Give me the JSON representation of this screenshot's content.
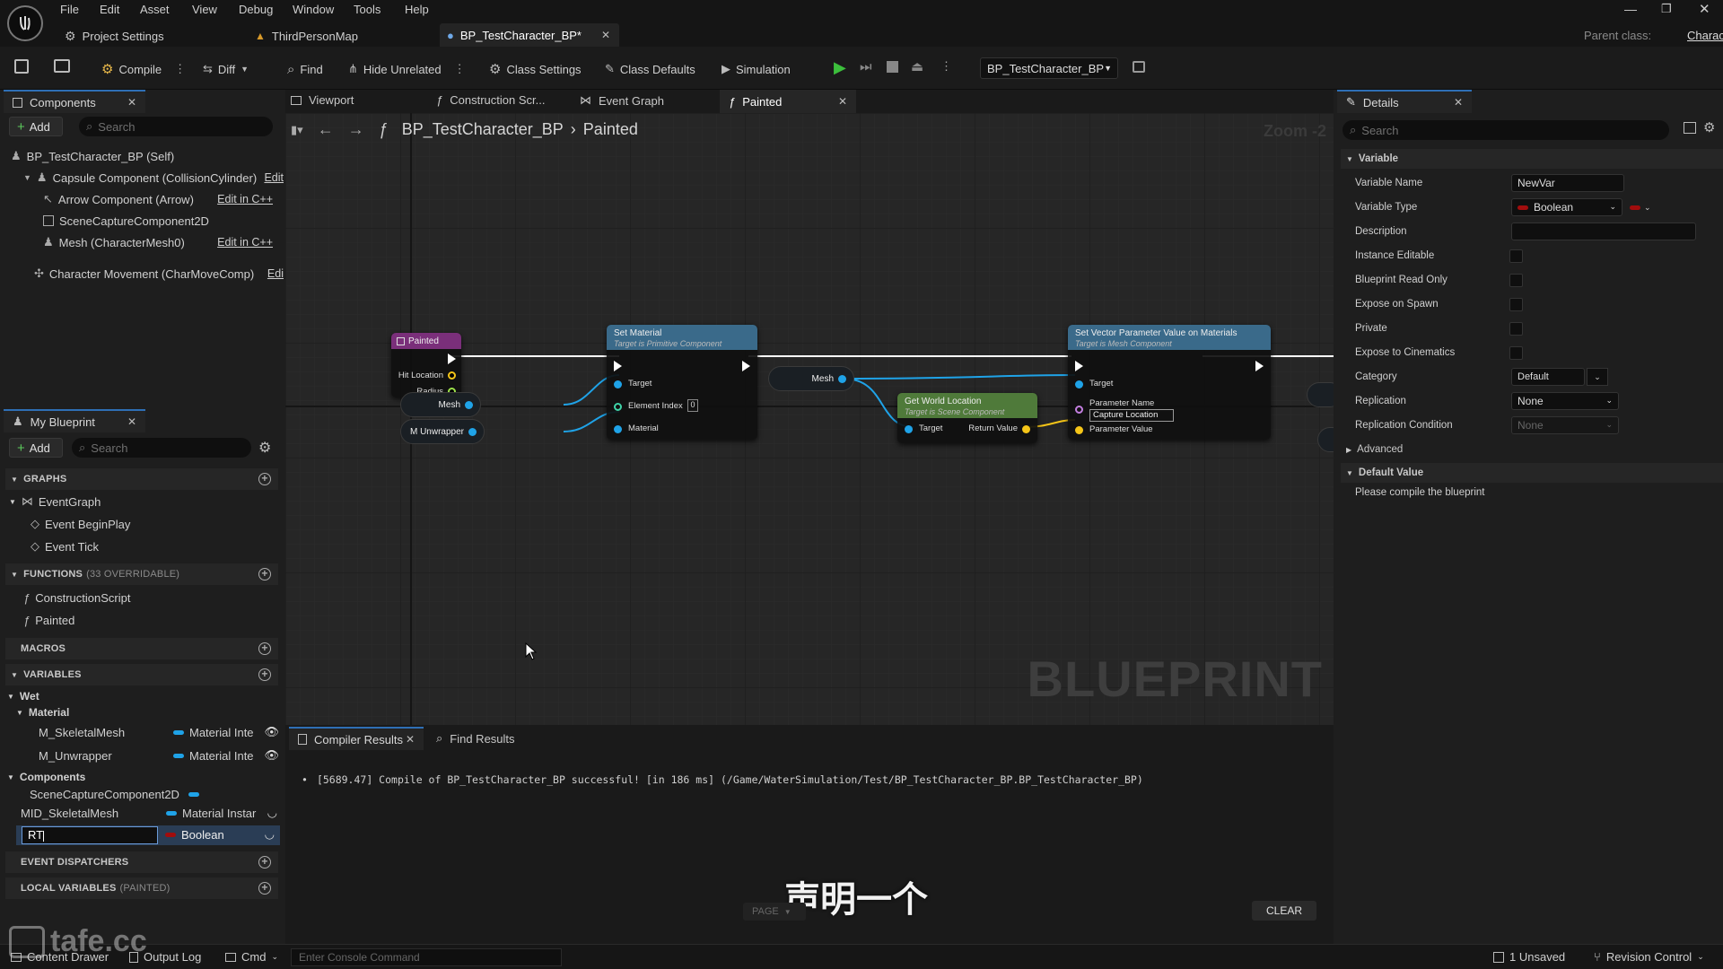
{
  "menu": [
    "File",
    "Edit",
    "Asset",
    "View",
    "Debug",
    "Window",
    "Tools",
    "Help"
  ],
  "doc_tabs": {
    "project_settings": "Project Settings",
    "third_person_map": "ThirdPersonMap",
    "bp_test": "BP_TestCharacter_BP*"
  },
  "parent_class": {
    "label": "Parent class:",
    "value": "Character"
  },
  "toolbar": {
    "compile": "Compile",
    "diff": "Diff",
    "find": "Find",
    "hide_unrelated": "Hide Unrelated",
    "class_settings": "Class Settings",
    "class_defaults": "Class Defaults",
    "simulation": "Simulation",
    "debug_object": "BP_TestCharacter_BP"
  },
  "components_panel": {
    "tab": "Components",
    "add": "Add",
    "search_placeholder": "Search",
    "self": "BP_TestCharacter_BP (Self)",
    "capsule": "Capsule Component (CollisionCylinder)",
    "capsule_edit": "Edit",
    "arrow": "Arrow Component (Arrow)",
    "arrow_edit": "Edit in C++",
    "scene_capture": "SceneCaptureComponent2D",
    "mesh": "Mesh (CharacterMesh0)",
    "mesh_edit": "Edit in C++",
    "movement": "Character Movement (CharMoveComp)",
    "movement_edit": "Edi"
  },
  "my_blueprint": {
    "tab": "My Blueprint",
    "add": "Add",
    "search_placeholder": "Search",
    "graphs_hdr": "GRAPHS",
    "event_graph": "EventGraph",
    "begin_play": "Event BeginPlay",
    "tick": "Event Tick",
    "functions_hdr": "FUNCTIONS",
    "functions_count": "(33 OVERRIDABLE)",
    "construction": "ConstructionScript",
    "painted": "Painted",
    "macros_hdr": "MACROS",
    "variables_hdr": "VARIABLES",
    "cat_wet": "Wet",
    "cat_material": "Material",
    "var_skeletal": "M_SkeletalMesh",
    "var_skeletal_type": "Material Inte",
    "var_unwrapper": "M_Unwrapper",
    "var_unwrapper_type": "Material Inte",
    "cat_components": "Components",
    "var_scenecap": "SceneCaptureComponent2D",
    "var_mid": "MID_SkeletalMesh",
    "var_mid_type": "Material Instar",
    "var_new_value": "RT",
    "var_new_type": "Boolean",
    "dispatchers_hdr": "EVENT DISPATCHERS",
    "locals_hdr": "LOCAL VARIABLES",
    "locals_sub": "(PAINTED)"
  },
  "graph_tabs": {
    "viewport": "Viewport",
    "construction": "Construction Scr...",
    "event_graph": "Event Graph",
    "painted": "Painted"
  },
  "breadcrumb": {
    "blueprint": "BP_TestCharacter_BP",
    "function": "Painted"
  },
  "zoom": "Zoom -2",
  "watermark": "BLUEPRINT",
  "nodes": {
    "painted": {
      "title": "Painted",
      "hit_location": "Hit Location",
      "radius": "Radius"
    },
    "mesh_var": "Mesh",
    "unwrapper_var": "M Unwrapper",
    "set_material": {
      "title": "Set Material",
      "sub": "Target is Primitive Component",
      "target": "Target",
      "element_index": "Element Index",
      "element_value": "0",
      "material": "Material"
    },
    "mesh_var2": "Mesh",
    "get_world_location": {
      "title": "Get World Location",
      "sub": "Target is Scene Component",
      "target": "Target",
      "return": "Return Value"
    },
    "set_vector": {
      "title": "Set Vector Parameter Value on Materials",
      "sub": "Target is Mesh Component",
      "target": "Target",
      "param_name": "Parameter Name",
      "param_name_value": "Capture Location",
      "param_value": "Parameter Value"
    }
  },
  "output": {
    "compiler_tab": "Compiler Results",
    "find_tab": "Find Results",
    "message": "[5689.47] Compile of BP_TestCharacter_BP successful! [in 186 ms] (/Game/WaterSimulation/Test/BP_TestCharacter_BP.BP_TestCharacter_BP)",
    "page": "PAGE",
    "clear": "CLEAR"
  },
  "subtitle": "声明一个",
  "details": {
    "tab": "Details",
    "search_placeholder": "Search",
    "variable_hdr": "Variable",
    "variable_name_lbl": "Variable Name",
    "variable_name": "NewVar",
    "variable_type_lbl": "Variable Type",
    "variable_type": "Boolean",
    "description_lbl": "Description",
    "instance_editable": "Instance Editable",
    "read_only": "Blueprint Read Only",
    "expose_spawn": "Expose on Spawn",
    "private": "Private",
    "expose_cinematics": "Expose to Cinematics",
    "category_lbl": "Category",
    "category": "Default",
    "replication_lbl": "Replication",
    "replication": "None",
    "replication_cond_lbl": "Replication Condition",
    "replication_cond": "None",
    "advanced": "Advanced",
    "default_value_hdr": "Default Value",
    "compile_msg": "Please compile the blueprint"
  },
  "statusbar": {
    "content_drawer": "Content Drawer",
    "output_log": "Output Log",
    "cmd": "Cmd",
    "console_placeholder": "Enter Console Command",
    "unsaved": "1 Unsaved",
    "revision": "Revision Control"
  },
  "logo_text": "tafe.cc",
  "colors": {
    "object_ref": "#1fa3e8",
    "boolean": "#a10d0d",
    "vector": "#f5c518",
    "exec": "#ffffff",
    "function_hdr": "#3a6a8a",
    "pure_hdr": "#4f7a3a",
    "event_hdr": "#7a2f7a",
    "accent": "#2e6fb5"
  }
}
